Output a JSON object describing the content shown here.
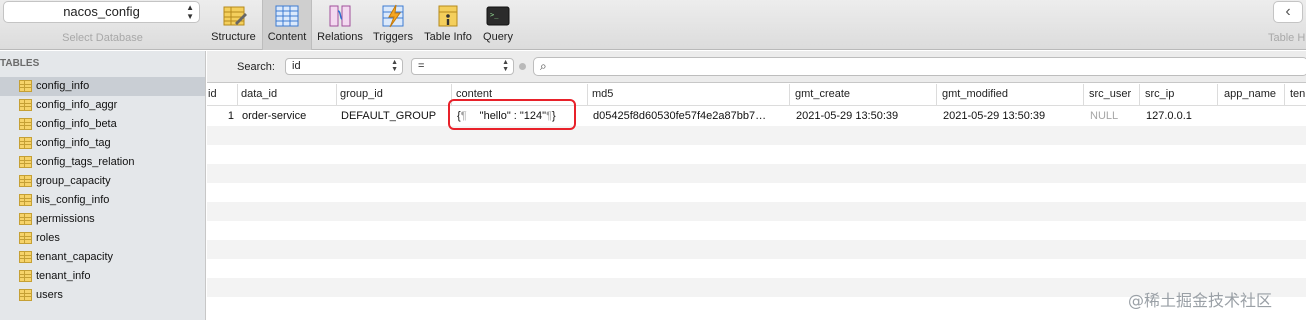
{
  "database": {
    "selected": "nacos_config",
    "caption": "Select Database"
  },
  "tabs": [
    {
      "label": "Structure",
      "icon": "structure-icon"
    },
    {
      "label": "Content",
      "icon": "content-icon",
      "active": true
    },
    {
      "label": "Relations",
      "icon": "relations-icon"
    },
    {
      "label": "Triggers",
      "icon": "triggers-icon"
    },
    {
      "label": "Table Info",
      "icon": "table-info-icon"
    },
    {
      "label": "Query",
      "icon": "query-icon"
    }
  ],
  "right_caption": "Table H",
  "back_label": "‹",
  "sidebar": {
    "header": "TABLES",
    "items": [
      "config_info",
      "config_info_aggr",
      "config_info_beta",
      "config_info_tag",
      "config_tags_relation",
      "group_capacity",
      "his_config_info",
      "permissions",
      "roles",
      "tenant_capacity",
      "tenant_info",
      "users"
    ],
    "selected": "config_info"
  },
  "filter": {
    "label": "Search:",
    "field": "id",
    "operator": "=",
    "value": ""
  },
  "columns": [
    "id",
    "data_id",
    "group_id",
    "content",
    "md5",
    "gmt_create",
    "gmt_modified",
    "src_user",
    "src_ip",
    "app_name",
    "ten"
  ],
  "rows": [
    {
      "id": "1",
      "data_id": "order-service",
      "group_id": "DEFAULT_GROUP",
      "content_open": "{",
      "content_body": "\"hello\" : \"124\"",
      "content_close": "}",
      "pilcrow": "¶",
      "md5": "d05425f8d60530fe57f4e2a87bb7…",
      "gmt_create": "2021-05-29 13:50:39",
      "gmt_modified": "2021-05-29 13:50:39",
      "src_user": "NULL",
      "src_ip": "127.0.0.1",
      "app_name": ""
    }
  ],
  "watermark": "@稀土掘金技术社区",
  "colors": {
    "highlight": "#e8212a",
    "selected_row": "#c9ced4",
    "sidebar_bg": "#e4e7ea"
  }
}
